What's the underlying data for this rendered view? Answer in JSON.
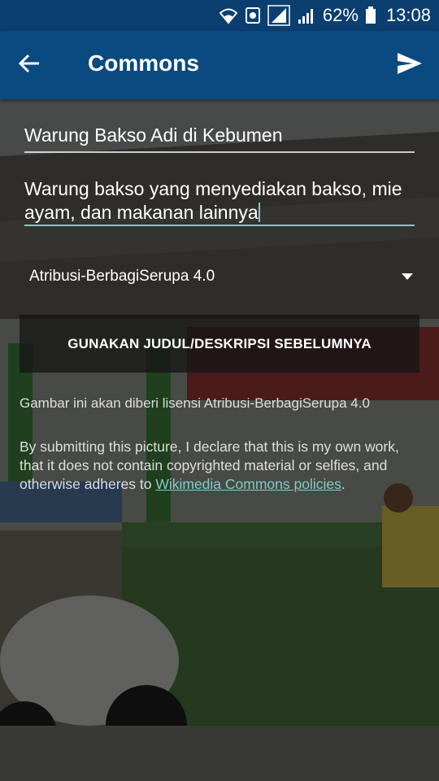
{
  "status": {
    "battery_percent": "62%",
    "time": "13:08",
    "icons": [
      "wifi-icon",
      "data-sync-icon",
      "signal-sim1-icon",
      "signal-sim2-icon",
      "battery-icon"
    ]
  },
  "toolbar": {
    "title": "Commons",
    "back_icon": "arrow-back-icon",
    "send_icon": "send-icon"
  },
  "form": {
    "title_value": "Warung Bakso Adi di Kebumen",
    "description_value": "Warung bakso yang menyediakan bakso, mie ayam, dan makanan lainnya",
    "license_selected": "Atribusi-BerbagiSerupa 4.0",
    "previous_button": "GUNAKAN JUDUL/DESKRIPSI SEBELUMNYA",
    "license_note": "Gambar ini akan diberi lisensi Atribusi-BerbagiSerupa 4.0",
    "declaration_text": "By submitting this picture, I declare that this is my own work, that it does not contain copyrighted material or selfies, and otherwise adheres to ",
    "declaration_link": "Wikimedia Commons policies",
    "declaration_end": "."
  },
  "colors": {
    "status_bar": "#0a3f70",
    "toolbar": "#0b4a80",
    "accent": "#80cbc4"
  }
}
